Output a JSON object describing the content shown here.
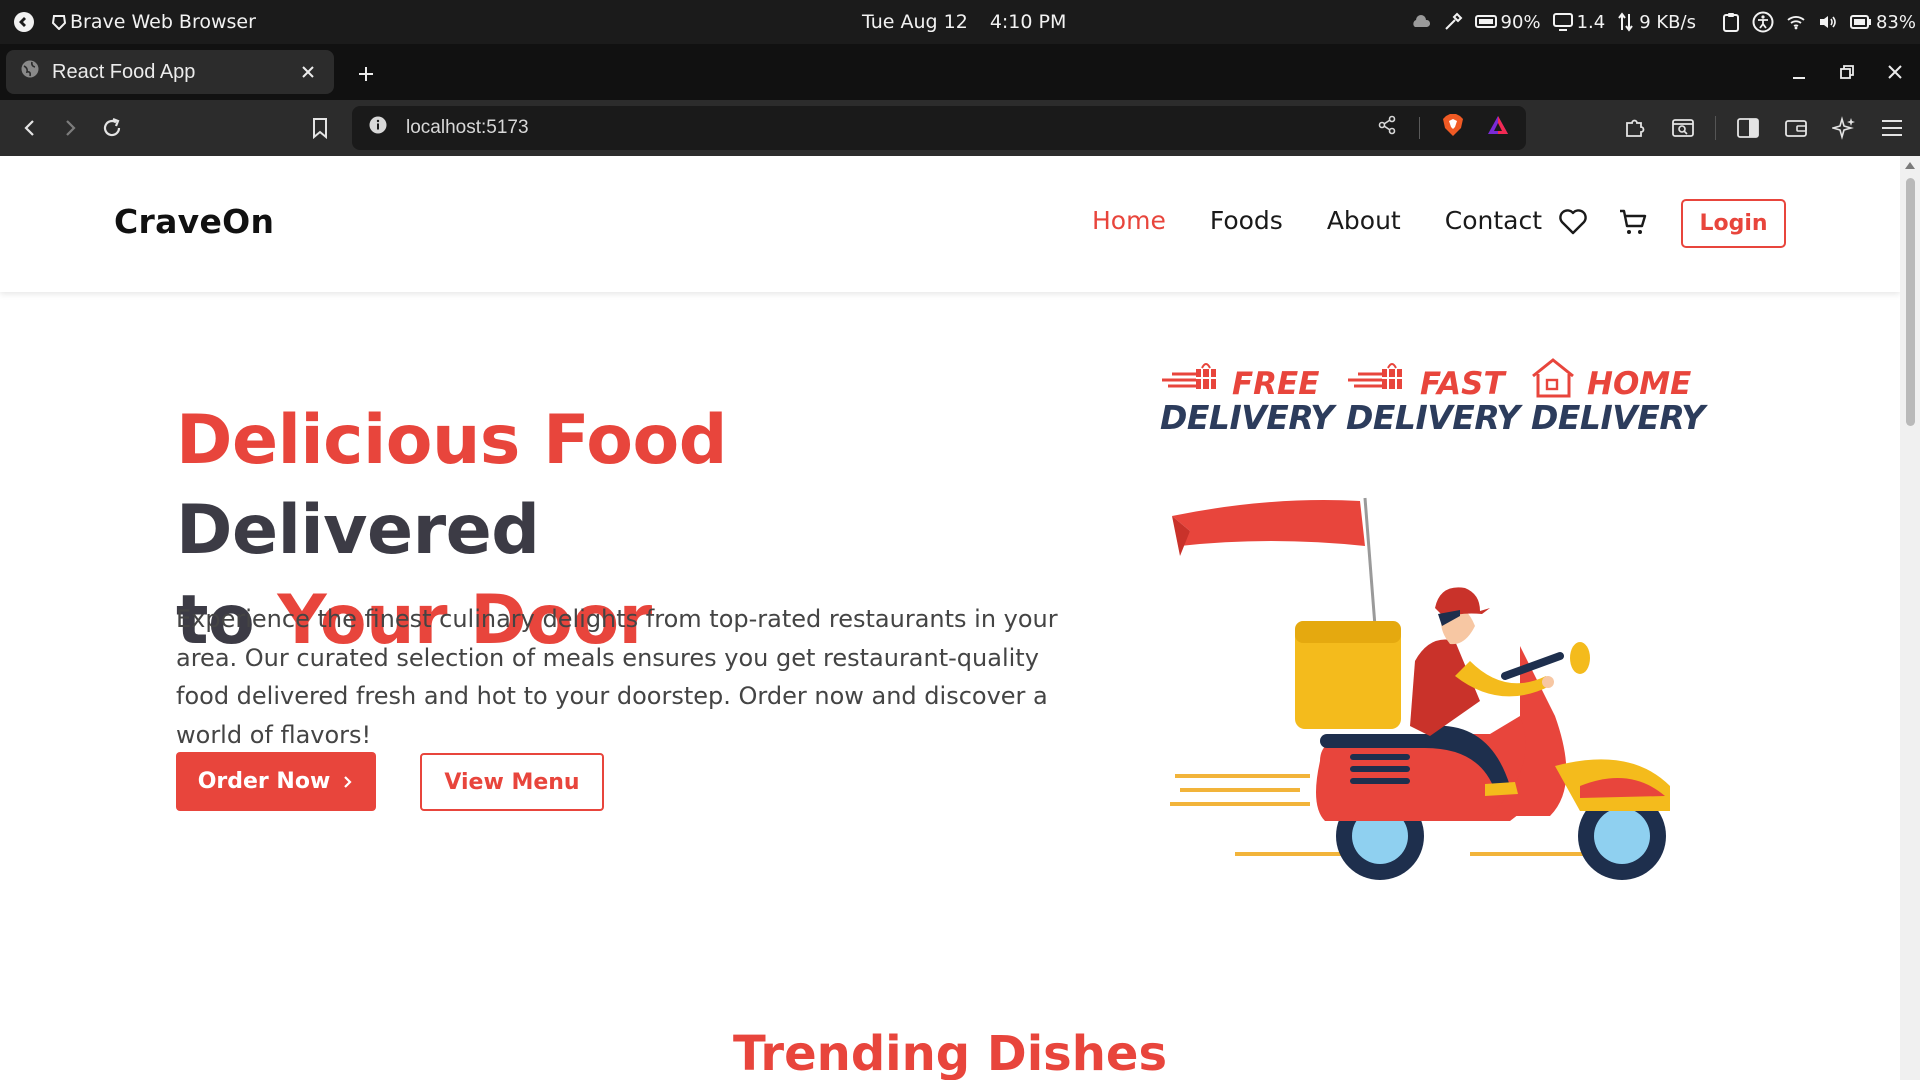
{
  "os": {
    "app_name": "Brave Web Browser",
    "date": "Tue Aug 12",
    "time": "4:10 PM",
    "memory": "90%",
    "load": "1.4",
    "network": "9 KB/s",
    "battery": "83%"
  },
  "browser": {
    "tab_title": "React Food App",
    "url": "localhost:5173"
  },
  "site": {
    "brand": "CraveOn",
    "nav": [
      "Home",
      "Foods",
      "About",
      "Contact"
    ],
    "active_nav": "Home",
    "login_label": "Login"
  },
  "hero": {
    "title_part1": "Delicious Food",
    "title_part2": " Delivered",
    "title_part3": "to ",
    "title_part4": "Your Door",
    "description": "Experience the finest culinary delights from top-rated restaurants in your area. Our curated selection of meals ensures you get restaurant-quality food delivered fresh and hot to your doorstep. Order now and discover a world of flavors!",
    "order_label": "Order Now",
    "menu_label": "View Menu"
  },
  "badges": [
    {
      "top": "FREE",
      "bottom": "DELIVERY"
    },
    {
      "top": "FAST",
      "bottom": "DELIVERY"
    },
    {
      "top": "HOME",
      "bottom": "DELIVERY"
    }
  ],
  "trending_title": "Trending Dishes",
  "colors": {
    "accent": "#e8453c",
    "dark_text": "#3c3b45",
    "badge_navy": "#2c3c5c"
  }
}
